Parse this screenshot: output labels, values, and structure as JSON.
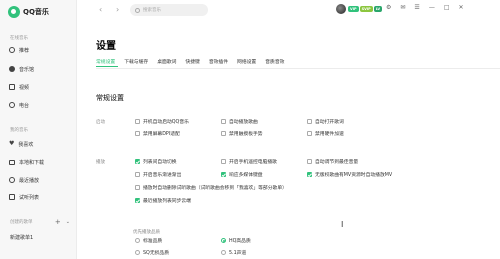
{
  "app": {
    "name": "QQ音乐"
  },
  "sidebar": {
    "online_title": "在线音乐",
    "online_items": [
      {
        "label": "推荐",
        "icon": "recommend-icon"
      },
      {
        "label": "音乐馆",
        "icon": "music-hall-icon"
      },
      {
        "label": "视频",
        "icon": "video-icon"
      },
      {
        "label": "电台",
        "icon": "radio-icon"
      }
    ],
    "my_title": "我的音乐",
    "my_items": [
      {
        "label": "我喜欢",
        "icon": "heart-icon"
      },
      {
        "label": "本地和下载",
        "icon": "local-download-icon"
      },
      {
        "label": "最近播放",
        "icon": "recent-icon"
      },
      {
        "label": "试听列表",
        "icon": "playlist-icon"
      }
    ],
    "created_title": "创建的歌单",
    "created_items": [
      "新建歌单1"
    ]
  },
  "topbar": {
    "back_glyph": "‹",
    "forward_glyph": "›",
    "search_placeholder": "搜索音乐",
    "badges": [
      "VIP",
      "SVIP",
      "LV"
    ],
    "controls": [
      "⚙",
      "✉",
      "☰",
      "—",
      "□",
      "✕"
    ]
  },
  "settings": {
    "title": "设置",
    "tabs": [
      "常规设置",
      "下载与缓存",
      "桌面歌词",
      "快捷键",
      "音效插件",
      "网络设置",
      "音质音效"
    ],
    "section_title": "常规设置",
    "startup_label": "启动",
    "startup_options": [
      {
        "label": "开机自动启动QQ音乐",
        "checked": false
      },
      {
        "label": "自动播放歌曲",
        "checked": false
      },
      {
        "label": "自动打开歌词",
        "checked": false
      },
      {
        "label": "禁用屏幕DPI适配",
        "checked": false
      },
      {
        "label": "禁用触摸板手势",
        "checked": false
      },
      {
        "label": "禁用硬件加速",
        "checked": false
      }
    ],
    "play_label": "播放",
    "play_options": [
      {
        "label": "列表间自动切换",
        "checked": true
      },
      {
        "label": "开启手机遥控电脑播歌",
        "checked": false
      },
      {
        "label": "自动调节到最佳音量",
        "checked": false
      },
      {
        "label": "开启音乐渐进渐出",
        "checked": false
      },
      {
        "label": "响应多媒体键盘",
        "checked": true
      },
      {
        "label": "无版权歌曲有MV资源时自动播放MV",
        "checked": true
      },
      {
        "label": "播放时自动删除试听歌曲（试听歌曲会移到「我喜欢」等部分歌单）",
        "checked": false
      },
      {
        "label": "最近播放列表同步云端",
        "checked": true
      }
    ],
    "quality_label": "优先播放品质",
    "quality_options": [
      {
        "label": "标准品质",
        "selected": false
      },
      {
        "label": "HQ高品质",
        "selected": true
      },
      {
        "label": "SQ无损品质",
        "selected": false
      },
      {
        "label": "5.1声道",
        "selected": false
      }
    ]
  },
  "colors": {
    "accent": "#31c27c"
  }
}
